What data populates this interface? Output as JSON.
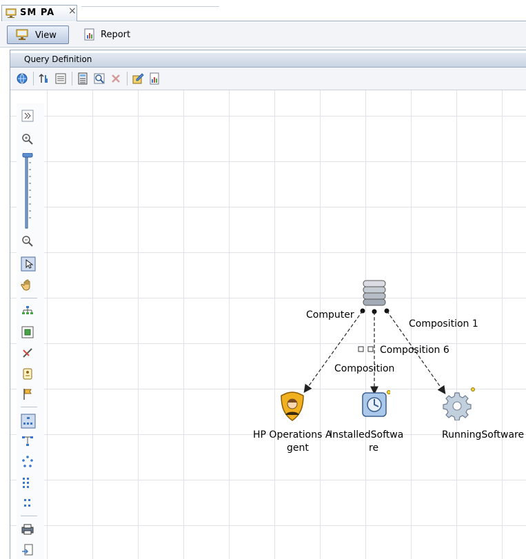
{
  "tab": {
    "title": "SM PA",
    "close_glyph": "×"
  },
  "modebar": {
    "view_label": "View",
    "report_label": "Report"
  },
  "panel": {
    "title": "Query Definition"
  },
  "graph": {
    "nodes": {
      "computer": {
        "icon": "server-stack-icon"
      },
      "hp_operations_agent": {
        "label_line1": "HP Operations A",
        "label_line2": "gent",
        "icon": "agent-shield-icon"
      },
      "installed_software": {
        "label_line1": "InstalledSoftwa",
        "label_line2": "re",
        "icon": "installed-software-icon"
      },
      "running_software": {
        "label_line1": "RunningSoftware",
        "icon": "gear-icon"
      }
    },
    "edges": {
      "to_agent": "Computer",
      "to_installed": "Composition",
      "to_installed_2": "Composition  6",
      "to_running": "Composition  1"
    }
  },
  "colors": {
    "accent": "#6f86a8",
    "grid": "#dfe3e8",
    "panel_header": "#c9d4e3"
  }
}
